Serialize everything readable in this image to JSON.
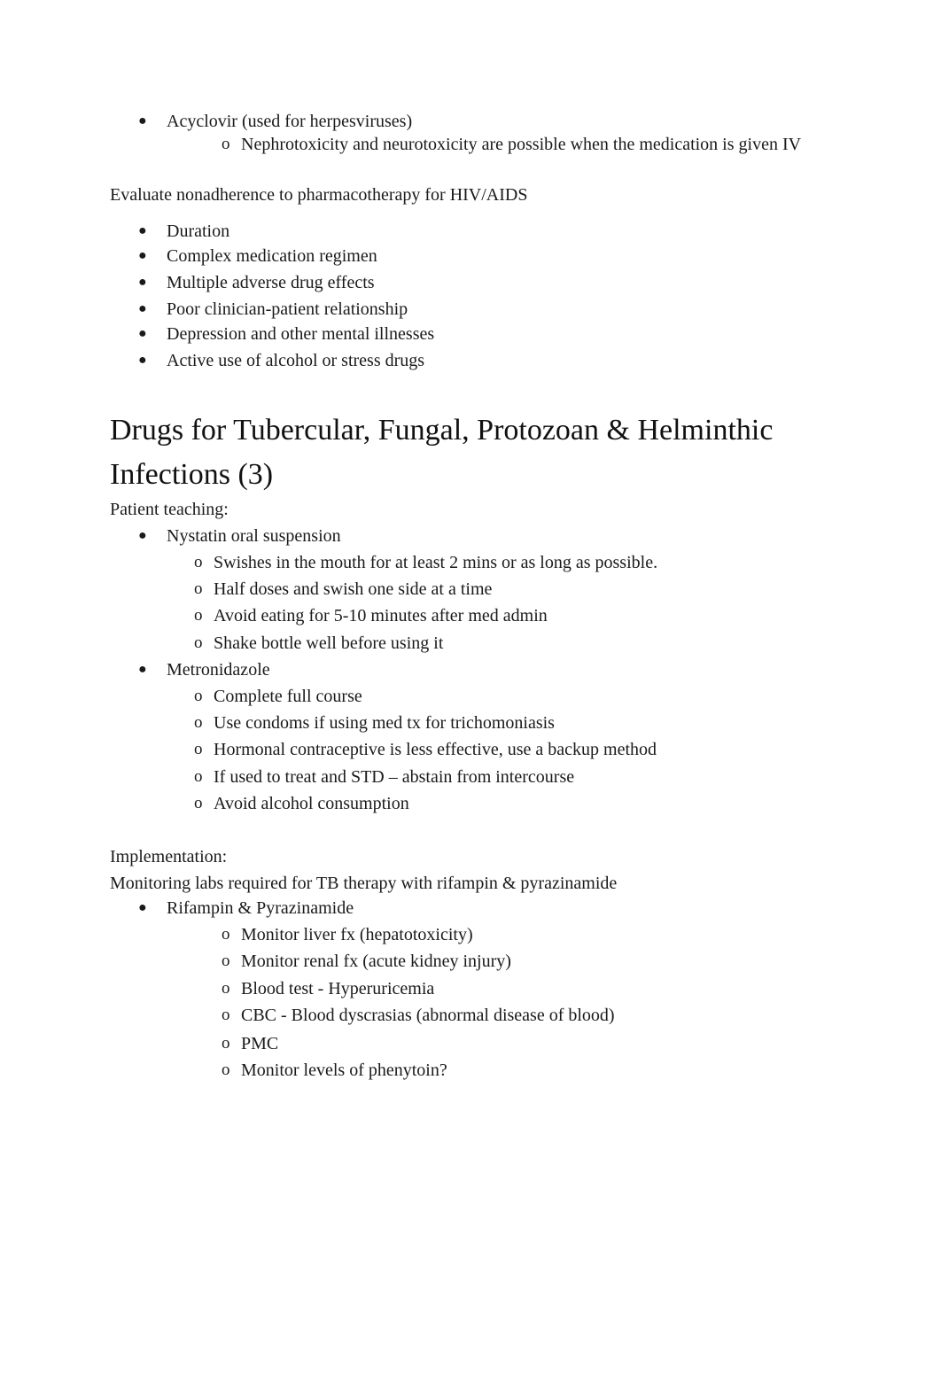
{
  "acyclovir": {
    "label": "Acyclovir (used for herpesviruses)",
    "subitems": [
      "Nephrotoxicity and neurotoxicity are possible when the medication is given IV"
    ]
  },
  "nonadherence": {
    "title": "Evaluate nonadherence to pharmacotherapy for HIV/AIDS",
    "items": [
      "Duration",
      "Complex medication regimen",
      "Multiple adverse drug effects",
      "Poor clinician-patient relationship",
      "Depression and other mental illnesses",
      "Active use of alcohol or stress drugs"
    ]
  },
  "section": {
    "heading_line1": "Drugs for Tubercular, Fungal, Protozoan & Helminthic",
    "heading_line2": "Infections (3)"
  },
  "patient_teaching": {
    "label": "Patient teaching:",
    "drugs": [
      {
        "name": "Nystatin oral suspension",
        "points": [
          "Swishes in the mouth for at least 2 mins or as long as possible.",
          "Half doses and swish one side at a time",
          "Avoid eating for 5-10 minutes after med admin",
          "Shake bottle well before using it"
        ]
      },
      {
        "name": "Metronidazole",
        "points": [
          "Complete full course",
          "Use condoms if using med tx for trichomoniasis",
          "Hormonal contraceptive is less effective, use a backup method",
          "If used to treat and STD – abstain from intercourse",
          "Avoid alcohol consumption"
        ]
      }
    ]
  },
  "implementation": {
    "label": "Implementation:",
    "subtitle": "Monitoring labs required for TB therapy with rifampin & pyrazinamide",
    "drug": "Rifampin & Pyrazinamide",
    "points": [
      "Monitor liver fx (hepatotoxicity)",
      "Monitor renal fx (acute kidney injury)",
      "Blood test - Hyperuricemia",
      "CBC - Blood dyscrasias (abnormal disease of blood)",
      "PMC",
      "Monitor levels of phenytoin?"
    ]
  },
  "glyphs": {
    "bullet": "●",
    "sub_bullet": "o"
  }
}
